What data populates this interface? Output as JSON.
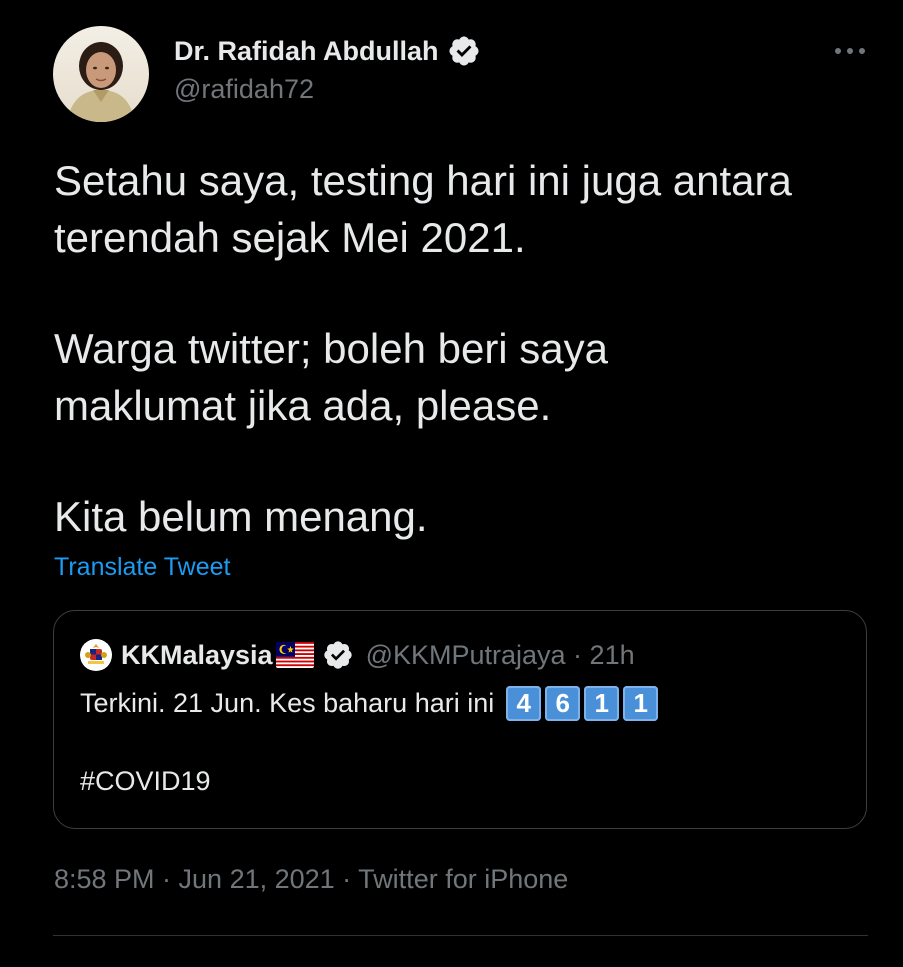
{
  "tweet": {
    "author": {
      "name": "Dr. Rafidah Abdullah",
      "handle": "@rafidah72",
      "verified_icon": "verified-badge-icon",
      "avatar_icon": "profile-photo"
    },
    "more_icon": "more-options-icon",
    "paragraphs": [
      [
        "Setahu saya, testing hari ini juga antara",
        "terendah sejak Mei 2021."
      ],
      [
        "Warga twitter; boleh beri saya",
        "maklumat jika ada, please."
      ],
      [
        "Kita belum menang."
      ]
    ],
    "translate_label": "Translate Tweet",
    "quoted": {
      "name": "KKMalaysia",
      "flag_icon": "malaysia-flag-icon",
      "verified_icon": "verified-badge-icon",
      "handle_time": "@KKMPutrajaya · 21h",
      "text": "Terkini. 21 Jun. Kes baharu hari ini",
      "keycaps": [
        "4",
        "6",
        "1",
        "1"
      ],
      "hashtag": "#COVID19"
    },
    "meta": "8:58 PM · Jun 21, 2021 · Twitter for iPhone"
  },
  "colors": {
    "background": "#000000",
    "text_primary": "#e7e9ea",
    "text_secondary": "#71767b",
    "link": "#1d9bf0",
    "border": "#2f3336"
  }
}
